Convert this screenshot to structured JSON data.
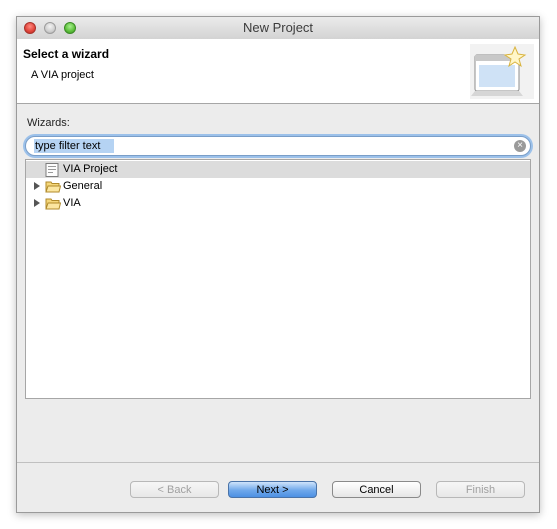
{
  "window": {
    "title": "New Project"
  },
  "banner": {
    "title": "Select a wizard",
    "description": "A VIA project"
  },
  "wizards": {
    "label": "Wizards:",
    "filter_value": "type filter text"
  },
  "tree": {
    "items": [
      {
        "label": "VIA Project",
        "kind": "project",
        "expandable": false,
        "selected": true
      },
      {
        "label": "General",
        "kind": "folder",
        "expandable": true,
        "selected": false
      },
      {
        "label": "VIA",
        "kind": "folder",
        "expandable": true,
        "selected": false
      }
    ]
  },
  "buttons": {
    "back": "< Back",
    "next": "Next >",
    "cancel": "Cancel",
    "finish": "Finish"
  }
}
